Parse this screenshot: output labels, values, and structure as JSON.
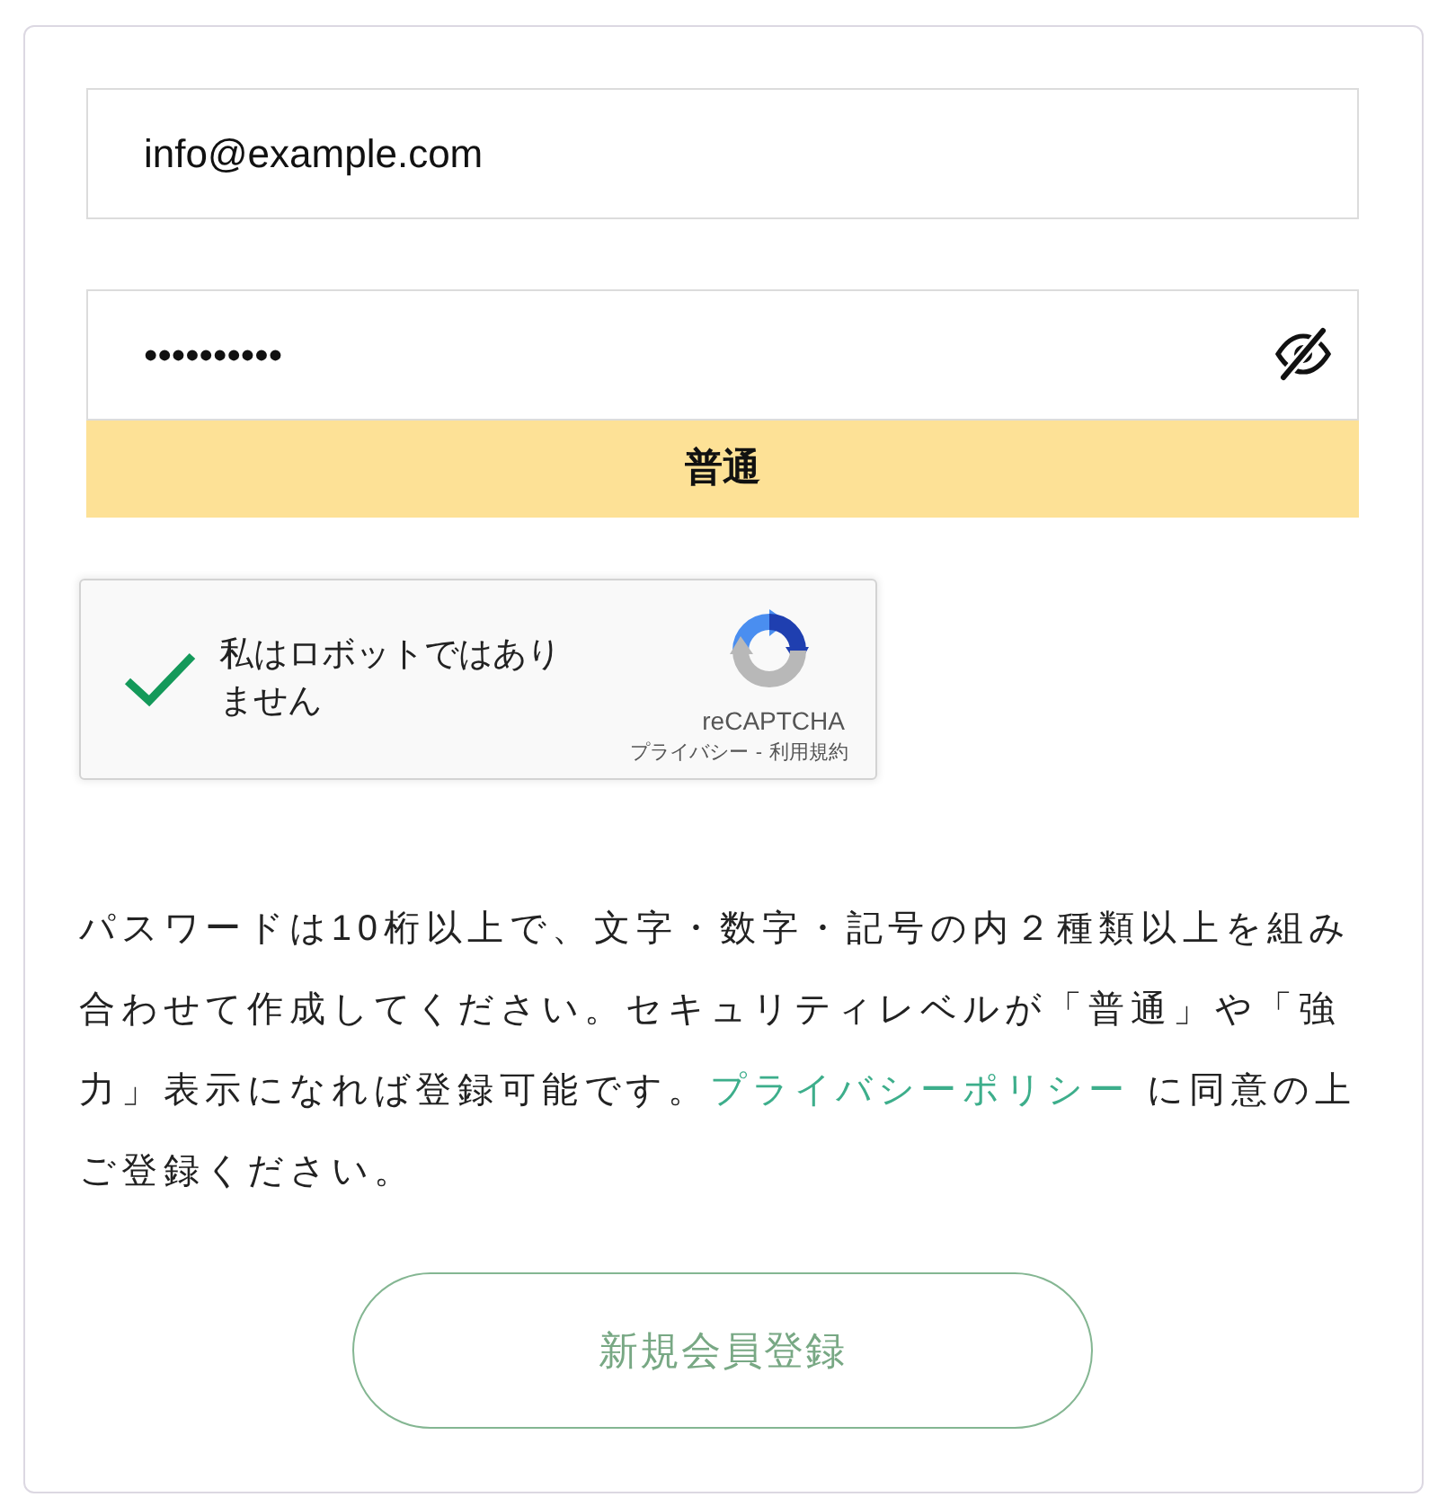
{
  "email_field": {
    "value": "info@example.com"
  },
  "password_field": {
    "value": "••••••••••"
  },
  "strength": {
    "label": "普通"
  },
  "captcha": {
    "checked": true,
    "label": "私はロボットではありません",
    "brand": "reCAPTCHA",
    "privacy_link": "プライバシー",
    "separator": "-",
    "terms_link": "利用規約"
  },
  "notice": {
    "text": "パスワードは10桁以上で、文字・数字・記号の内２種類以上を組み合わせて作成してください。セキュリティレベルが「普通」や「強力」表示になれば登録可能です。",
    "link": "プライバシーポリシー",
    "after": " に同意の上ご登録ください。"
  },
  "register_button": {
    "label": "新規会員登録"
  }
}
